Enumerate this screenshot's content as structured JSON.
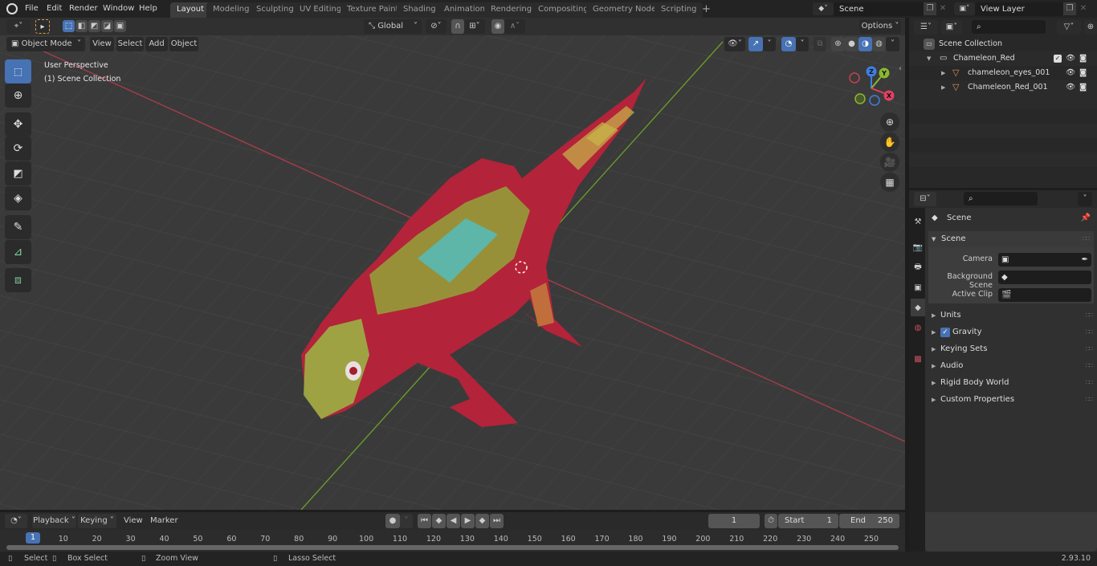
{
  "topbar": {
    "menu": [
      "File",
      "Edit",
      "Render",
      "Window",
      "Help"
    ],
    "workspaces": [
      "Layout",
      "Modeling",
      "Sculpting",
      "UV Editing",
      "Texture Paint",
      "Shading",
      "Animation",
      "Rendering",
      "Compositing",
      "Geometry Nodes",
      "Scripting"
    ],
    "active_workspace": "Layout",
    "add_workspace": "+",
    "scene_name": "Scene",
    "view_layer": "View Layer"
  },
  "viewport": {
    "mode": "Object Mode",
    "menus": [
      "View",
      "Select",
      "Add",
      "Object"
    ],
    "transform_orientation": "Global",
    "options_label": "Options",
    "overlay_text": [
      "User Perspective",
      "(1) Scene Collection"
    ],
    "gizmo_axes": [
      "X",
      "Y",
      "Z"
    ],
    "tools": [
      "select-box",
      "cursor",
      "move",
      "rotate",
      "scale",
      "transform",
      "annotate",
      "measure",
      "add-cube"
    ],
    "shading_mode": "material-preview"
  },
  "outliner": {
    "search_placeholder": "",
    "root": "Scene Collection",
    "items": [
      {
        "name": "Chameleon_Red",
        "type": "collection",
        "checked": true
      },
      {
        "name": "chameleon_eyes_001",
        "type": "mesh"
      },
      {
        "name": "Chameleon_Red_001",
        "type": "mesh"
      }
    ]
  },
  "properties": {
    "context": "Scene",
    "panel_title": "Scene",
    "fields": [
      {
        "label": "Camera",
        "value": ""
      },
      {
        "label": "Background Scene",
        "value": ""
      },
      {
        "label": "Active Clip",
        "value": ""
      }
    ],
    "subpanels": [
      "Units",
      "Gravity",
      "Keying Sets",
      "Audio",
      "Rigid Body World",
      "Custom Properties"
    ],
    "gravity_enabled": true
  },
  "timeline": {
    "menus": [
      "Playback",
      "Keying",
      "View",
      "Marker"
    ],
    "current_frame": "1",
    "start_label": "Start",
    "start": "1",
    "end_label": "End",
    "end": "250",
    "ticks": [
      "10",
      "20",
      "30",
      "40",
      "50",
      "60",
      "70",
      "80",
      "90",
      "100",
      "110",
      "120",
      "130",
      "140",
      "150",
      "160",
      "170",
      "180",
      "190",
      "200",
      "210",
      "220",
      "230",
      "240",
      "250"
    ],
    "playhead": "1"
  },
  "statusbar": {
    "hints": [
      "Select",
      "Box Select",
      "Zoom View",
      "Lasso Select"
    ],
    "version": "2.93.10"
  }
}
